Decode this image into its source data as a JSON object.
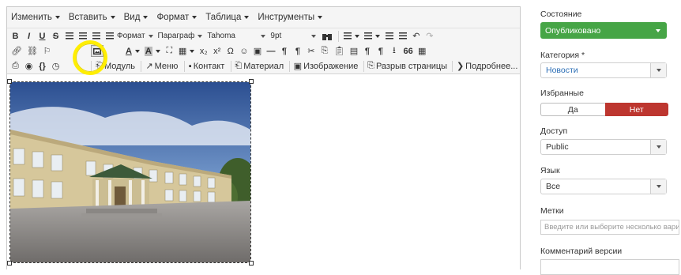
{
  "menubar": {
    "items": [
      "Изменить",
      "Вставить",
      "Вид",
      "Формат",
      "Таблица",
      "Инструменты"
    ]
  },
  "toolbar": {
    "row1": {
      "bold": "B",
      "italic": "I",
      "underline": "U",
      "strike": "S",
      "format": "Формат",
      "paragraph": "Параграф",
      "font": "Tahoma",
      "size": "9pt"
    },
    "row2": {
      "subscript": "x₂",
      "superscript": "x²",
      "omega": "Ω",
      "pilcrow": "¶",
      "quote": "66"
    },
    "row3": {
      "code": "{}",
      "module": "Модуль",
      "menu": "Меню",
      "contact": "Контакт",
      "material": "Материал",
      "image": "Изображение",
      "pagebreak": "Разрыв страницы",
      "more": "Подробнее..."
    }
  },
  "sidebar": {
    "state_label": "Состояние",
    "state_value": "Опубликовано",
    "category_label": "Категория *",
    "category_value": "Новости",
    "featured_label": "Избранные",
    "featured_yes": "Да",
    "featured_no": "Нет",
    "access_label": "Доступ",
    "access_value": "Public",
    "language_label": "Язык",
    "language_value": "Все",
    "tags_label": "Метки",
    "tags_placeholder": "Введите или выберите несколько вари",
    "version_note_label": "Комментарий версии"
  },
  "colors": {
    "published": "#46a546",
    "no": "#bd362f",
    "highlight": "#ffee00"
  }
}
